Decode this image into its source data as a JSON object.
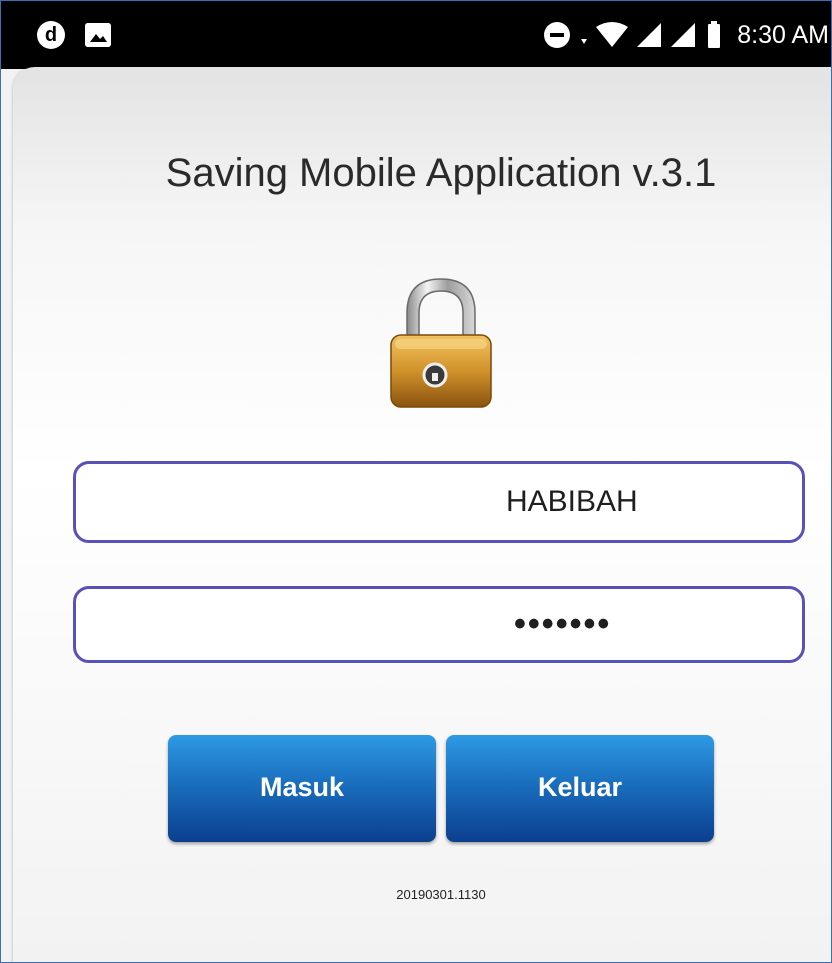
{
  "status_bar": {
    "time": "8:30 AM",
    "left_icons": [
      "d-app-icon",
      "image-icon"
    ],
    "right_icons": [
      "dnd-icon",
      "data-arrows-icon",
      "wifi-icon",
      "signal-icon",
      "signal-icon-2",
      "battery-icon"
    ],
    "d_icon_letter": "d"
  },
  "login": {
    "app_title": "Saving Mobile Application v.3.1",
    "lock_icon": "padlock-icon",
    "username_value": "HABIBAH",
    "password_value": "•••••••",
    "masuk_label": "Masuk",
    "keluar_label": "Keluar",
    "version": "20190301.1130"
  },
  "colors": {
    "field_border": "#5852b8",
    "button_top": "#2e9ae4",
    "button_bottom": "#0b3f8e",
    "status_bar": "#000000"
  }
}
